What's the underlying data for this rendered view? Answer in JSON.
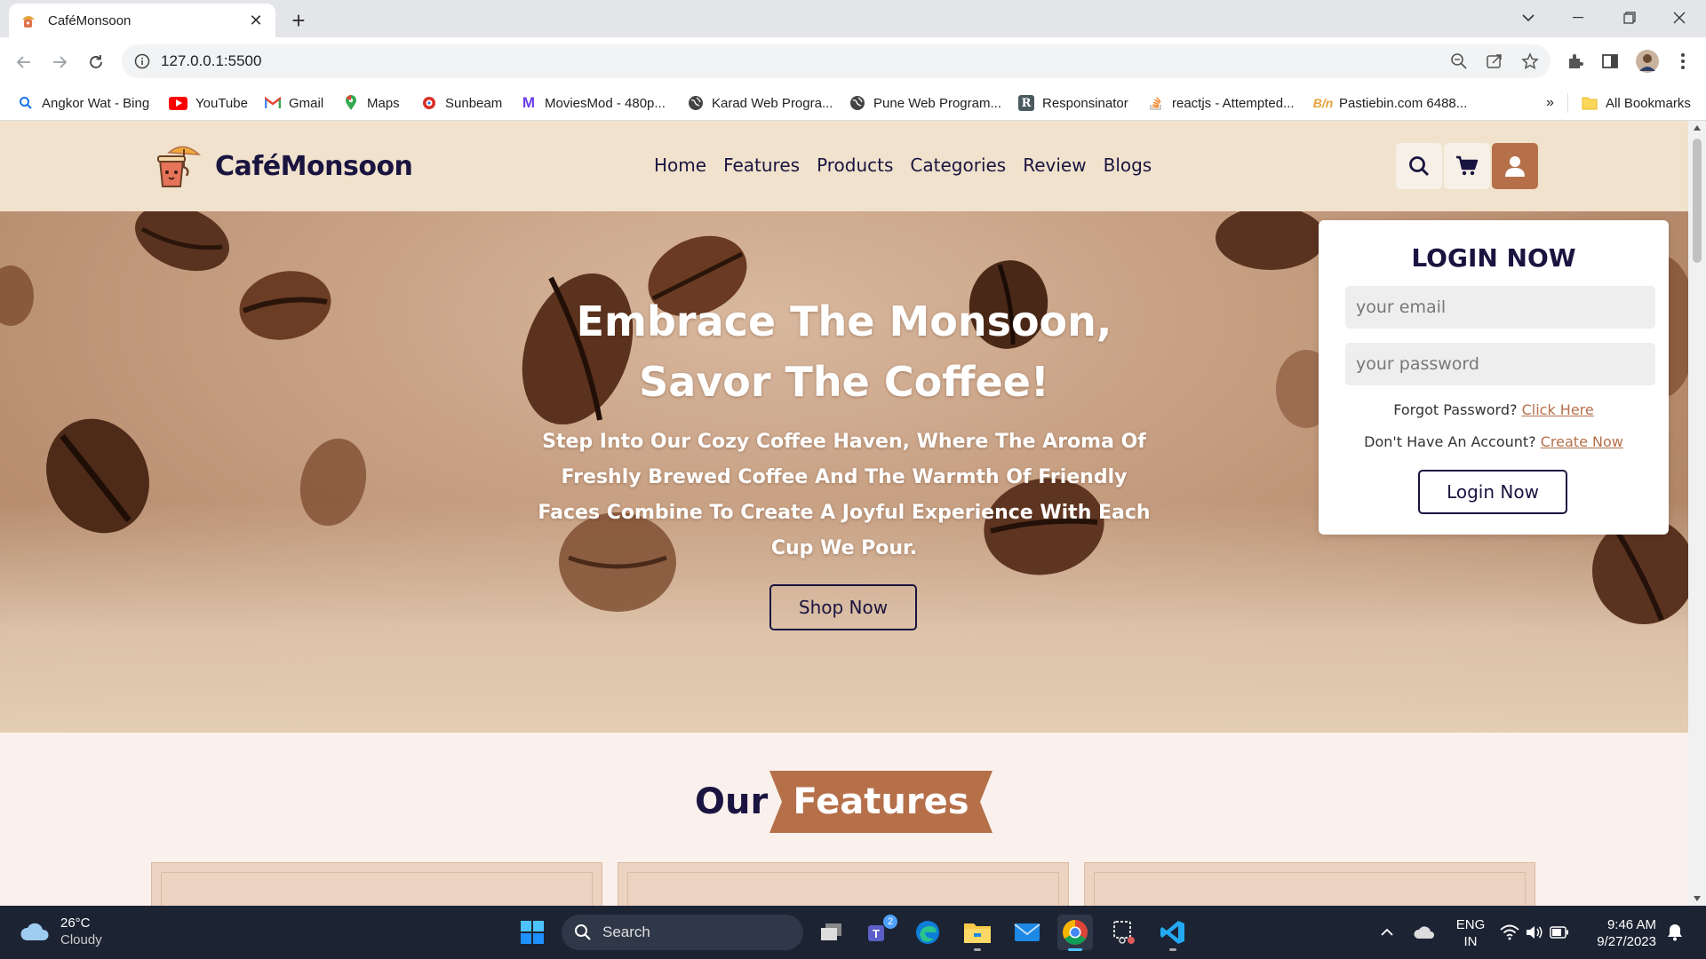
{
  "browser": {
    "tab_title": "CaféMonsoon",
    "url": "127.0.0.1:5500"
  },
  "bookmarks": [
    {
      "label": "Angkor Wat - Bing",
      "icon": "bing-search-icon"
    },
    {
      "label": "YouTube",
      "icon": "youtube-icon"
    },
    {
      "label": "Gmail",
      "icon": "gmail-icon"
    },
    {
      "label": "Maps",
      "icon": "maps-pin-icon"
    },
    {
      "label": "Sunbeam",
      "icon": "sunbeam-icon"
    },
    {
      "label": "MoviesMod - 480p...",
      "icon": "moviesmod-icon"
    },
    {
      "label": "Karad Web Progra...",
      "icon": "globe-icon"
    },
    {
      "label": "Pune Web Program...",
      "icon": "globe-icon"
    },
    {
      "label": "Responsinator",
      "icon": "responsinator-icon"
    },
    {
      "label": "reactjs - Attempted...",
      "icon": "stackoverflow-icon"
    },
    {
      "label": "Pastiebin.com 6488...",
      "icon": "pastebin-icon"
    }
  ],
  "all_bookmarks": "All Bookmarks",
  "site": {
    "logo_text": "CaféMonsoon",
    "nav": [
      "Home",
      "Features",
      "Products",
      "Categories",
      "Review",
      "Blogs"
    ]
  },
  "hero": {
    "title_line1": "Embrace The Monsoon,",
    "title_line2": "Savor The Coffee!",
    "subtitle": "Step Into Our Cozy Coffee Haven, Where The Aroma Of Freshly Brewed Coffee And The Warmth Of Friendly Faces Combine To Create A Joyful Experience With Each Cup We Pour.",
    "cta": "Shop Now"
  },
  "login": {
    "heading": "LOGIN NOW",
    "email_placeholder": "your email",
    "password_placeholder": "your password",
    "forgot_text": "Forgot Password?",
    "forgot_link": "Click Here",
    "no_account_text": "Don't Have An Account?",
    "create_link": "Create Now",
    "button": "Login Now"
  },
  "features": {
    "heading_prefix": "Our",
    "heading_highlight": "Features"
  },
  "colors": {
    "brand_dark": "#1a1440",
    "accent_brown": "#b5704a",
    "header_bg": "#f0e2cc"
  },
  "taskbar": {
    "temperature": "26°C",
    "weather": "Cloudy",
    "search": "Search",
    "teams_badge": "2",
    "language": "ENG",
    "region": "IN",
    "time": "9:46 AM",
    "date": "9/27/2023"
  }
}
